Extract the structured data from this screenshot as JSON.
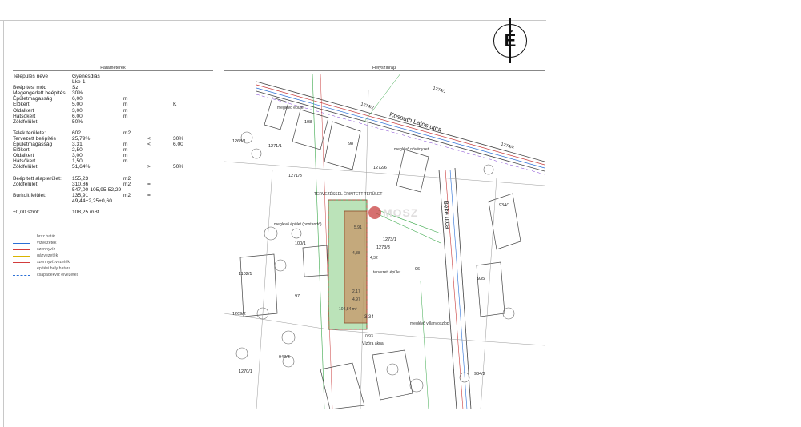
{
  "north_arrow": "É",
  "sections": {
    "params": "Paraméterek",
    "location": "Helyszínrajz"
  },
  "params": [
    {
      "c1": "Település neve",
      "c2": "Gyenesdiás"
    },
    {
      "c1": "",
      "c2": "Lke-1"
    },
    {
      "c1": "Beépítési mód",
      "c2": "Sz"
    },
    {
      "c1": "Megengedett beépítés",
      "c2": "30%"
    },
    {
      "c1": "Épületmagasság",
      "c2": "6,00",
      "c3": "m"
    },
    {
      "c1": "Előkert:",
      "c2": "5,00",
      "c3": "m",
      "c5": "K"
    },
    {
      "c1": "Oldalkert",
      "c2": "3,00",
      "c3": "m"
    },
    {
      "c1": "Hátsókert",
      "c2": "6,00",
      "c3": "m"
    },
    {
      "c1": "Zöldfelület",
      "c2": "50%"
    },
    {
      "gap": true
    },
    {
      "c1": "Telek területe:",
      "c2": "602",
      "c3": "m2"
    },
    {
      "c1": "Tervezett beépítés",
      "c2": "25,79%",
      "c4": "<",
      "c5": "30%"
    },
    {
      "c1": "Épületmagasság",
      "c2": "3,31",
      "c3": "m",
      "c4": "<",
      "c5": "6,00"
    },
    {
      "c1": "Előkert",
      "c2": "2,50",
      "c3": "m"
    },
    {
      "c1": "Oldalkert",
      "c2": "3,00",
      "c3": "m"
    },
    {
      "c1": "Hátsókert",
      "c2": "1,50",
      "c3": "m"
    },
    {
      "c1": "Zöldfelület",
      "c2": "51,64%",
      "c4": ">",
      "c5": "50%"
    },
    {
      "gap": true
    },
    {
      "c1": "Beépített alapterület:",
      "c2": "155,23",
      "c3": "m2"
    },
    {
      "c1": "Zöldfelület:",
      "c2": "310,86",
      "c3": "m2",
      "c4": "="
    },
    {
      "c1": "",
      "c2": "547,00-105,95-52,29"
    },
    {
      "c1": "Burkolt felület:",
      "c2": "135,91",
      "c3": "m2",
      "c4": "="
    },
    {
      "c1": "",
      "c2": "49,44+2,25+0,60"
    },
    {
      "gap": true
    },
    {
      "c1": "±0,00 szint:",
      "c2": "108,25 mBf"
    }
  ],
  "legend": [
    {
      "label": "hrsz.határ",
      "color": "#b0b0b0",
      "style": "solid"
    },
    {
      "label": "vízvezeték",
      "color": "#2a6fd6",
      "style": "solid"
    },
    {
      "label": "szennyvíz",
      "color": "#d23c3c",
      "style": "solid"
    },
    {
      "label": "gázvezeték",
      "color": "#d9b400",
      "style": "solid"
    },
    {
      "label": "szennyvízvezeték",
      "color": "#d23c3c",
      "style": "solid"
    },
    {
      "label": "építési hely határa",
      "color": "#d23c3c",
      "style": "dashed"
    },
    {
      "label": "csapadékvíz elvezetés",
      "color": "#2a6fd6",
      "style": "dashed"
    }
  ],
  "map": {
    "streets": [
      "Kossuth Lajos utca",
      "Béke utca"
    ],
    "parcels": [
      "1274/2",
      "1274/1",
      "1274/4",
      "1271/1",
      "1268/1",
      "1272/6",
      "1271/3",
      "108",
      "98",
      "100/1",
      "1273/3",
      "1273/1",
      "1270/1",
      "1269/2",
      "943/3",
      "934/1",
      "934/2",
      "935",
      "1102/1",
      "97",
      "96"
    ],
    "area_label": "104,84 m²",
    "dimensions": [
      "4,32",
      "4,38",
      "2,17",
      "4,97",
      "3,34",
      "5,91",
      "0,93"
    ],
    "notes": [
      "meglévő épület",
      "TERVEZÉSSEL ÉRINTETT TERÜLET",
      "meglévő növényzet",
      "tervezett épület",
      "meglévő épület (bontandó)",
      "Vízóra akna",
      "meglévő villanyoszlop"
    ],
    "watermark": "MOSZ"
  }
}
